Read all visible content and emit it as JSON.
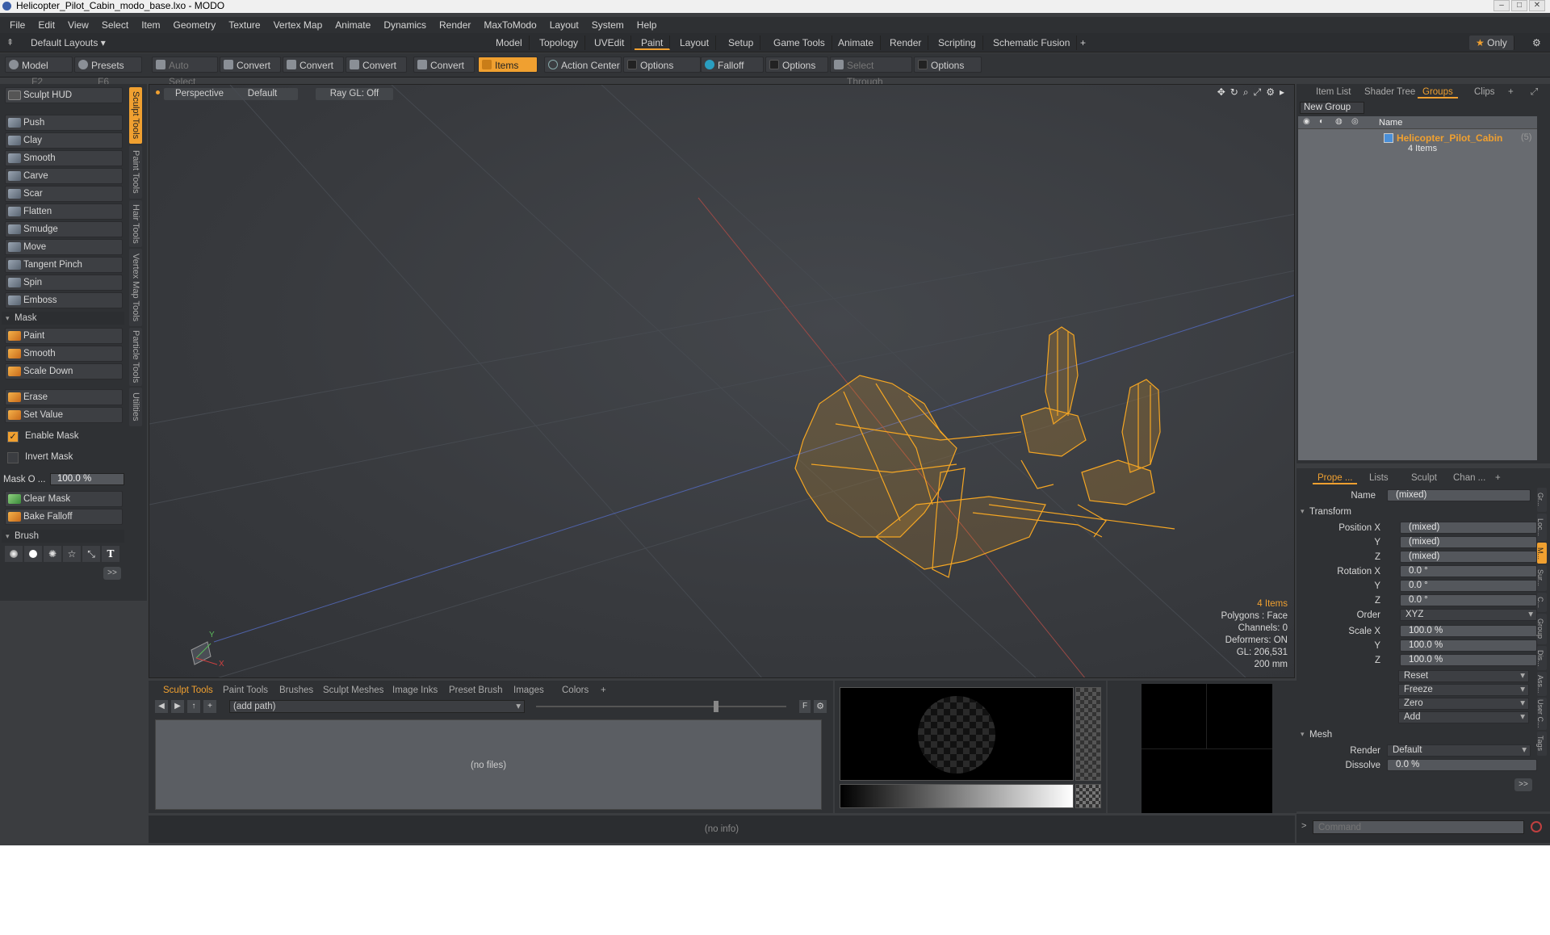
{
  "window": {
    "title": "Helicopter_Pilot_Cabin_modo_base.lxo - MODO"
  },
  "menu": [
    "File",
    "Edit",
    "View",
    "Select",
    "Item",
    "Geometry",
    "Texture",
    "Vertex Map",
    "Animate",
    "Dynamics",
    "Render",
    "MaxToModo",
    "Layout",
    "System",
    "Help"
  ],
  "layoutbar": {
    "layouts_dropdown": "Default Layouts",
    "tabs": [
      "Model",
      "Topology",
      "UVEdit",
      "Paint",
      "Layout",
      "Setup",
      "Game Tools",
      "Animate",
      "Render",
      "Scripting",
      "Schematic Fusion"
    ],
    "active_tab": "Paint",
    "only_label": "Only"
  },
  "toolbar": {
    "model": "Model",
    "model_key": "F2",
    "presets": "Presets",
    "presets_key": "F6",
    "auto_select": "Auto Select",
    "convert": "Convert",
    "items": "Items",
    "action_center": "Action Center",
    "options": "Options",
    "falloff": "Falloff",
    "select_through": "Select Through"
  },
  "sculpt": {
    "hud": "Sculpt HUD",
    "tools": [
      "Push",
      "Clay",
      "Smooth",
      "Carve",
      "Scar",
      "Flatten",
      "Smudge",
      "Move",
      "Tangent Pinch",
      "Spin",
      "Emboss"
    ],
    "mask_header": "Mask",
    "mask_tools": [
      "Paint",
      "Smooth",
      "Scale Down"
    ],
    "erase": "Erase",
    "set_value": "Set Value",
    "enable_mask": "Enable Mask",
    "invert_mask": "Invert Mask",
    "mask_opacity_label": "Mask O ...",
    "mask_opacity_value": "100.0 %",
    "clear_mask": "Clear Mask",
    "bake_falloff": "Bake Falloff",
    "brush_header": "Brush",
    "more": ">>",
    "text_tool": "T"
  },
  "side_tabs": [
    "Sculpt Tools",
    "Paint Tools",
    "Hair Tools",
    "Vertex Map Tools",
    "Particle Tools",
    "Utilities"
  ],
  "viewport": {
    "view": "Perspective",
    "shading": "Default",
    "raygl": "Ray GL: Off",
    "stats": {
      "items": "4 Items",
      "polygons": "Polygons : Face",
      "channels": "Channels: 0",
      "deformers": "Deformers: ON",
      "gl": "GL: 206,531",
      "scale": "200 mm"
    },
    "axis_y": "Y",
    "axis_x": "X"
  },
  "bottom": {
    "tabs": [
      "Sculpt Tools",
      "Paint Tools",
      "Brushes",
      "Sculpt Meshes",
      "Image Inks",
      "Preset Brush",
      "Images",
      "Colors"
    ],
    "path": "(add path)",
    "empty": "(no files)",
    "f": "F"
  },
  "info": "(no info)",
  "groups_panel": {
    "tabs": [
      "Item List",
      "Shader Tree",
      "Groups",
      "Clips"
    ],
    "new_group": "New Group",
    "name_col": "Name",
    "group_name": "Helicopter_Pilot_Cabin",
    "group_count": "(5)",
    "group_items": "4 Items"
  },
  "properties": {
    "tabs": [
      "Prope ...",
      "Lists",
      "Sculpt",
      "Chan ..."
    ],
    "name_label": "Name",
    "name_value": "(mixed)",
    "transform": "Transform",
    "position_label": "Position X",
    "position": [
      "(mixed)",
      "(mixed)",
      "(mixed)"
    ],
    "rotation_label": "Rotation X",
    "rotation": [
      "0.0 °",
      "0.0 °",
      "0.0 °"
    ],
    "order_label": "Order",
    "order": "XYZ",
    "scale_label": "Scale X",
    "scale": [
      "100.0 %",
      "100.0 %",
      "100.0 %"
    ],
    "y": "Y",
    "z": "Z",
    "reset": "Reset",
    "freeze": "Freeze",
    "zero": "Zero",
    "add": "Add",
    "mesh": "Mesh",
    "render_label": "Render",
    "render": "Default",
    "dissolve_label": "Dissolve",
    "dissolve": "0.0 %",
    "more": ">>"
  },
  "right_side_tabs": [
    "Gr...",
    "Loc...",
    "M...",
    "Sur...",
    "C...",
    "Group",
    "Dis...",
    "Ass...",
    "User C...",
    "Tags"
  ],
  "command": {
    "placeholder": "Command",
    "prompt": ">"
  },
  "colors": {
    "accent": "#f0a030",
    "wireframe": "#f5a623"
  }
}
